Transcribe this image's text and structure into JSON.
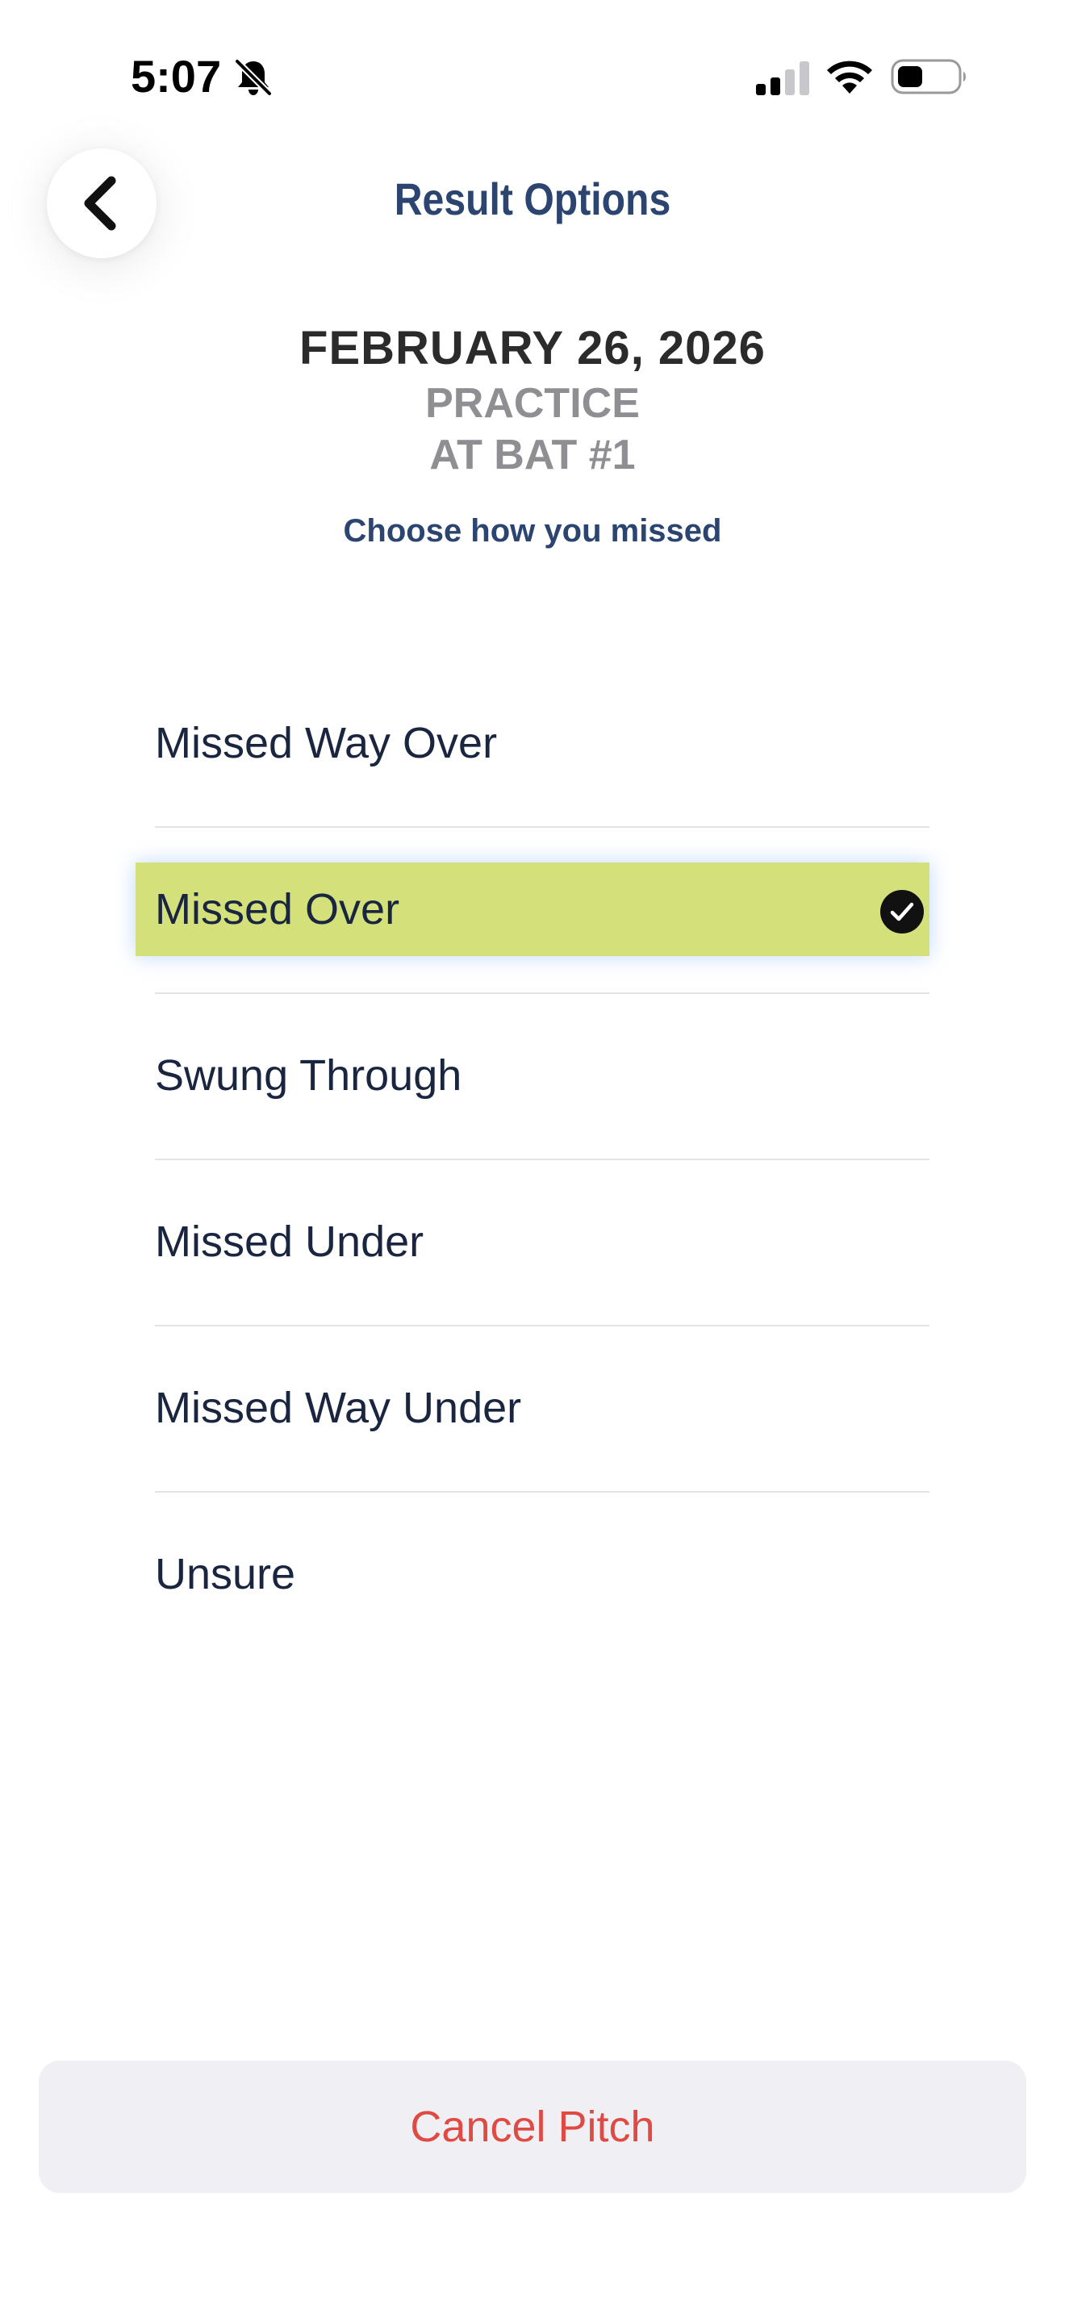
{
  "status_bar": {
    "time": "5:07",
    "icons": [
      "bell-slash-icon",
      "cellular-signal-icon",
      "wifi-icon",
      "battery-icon"
    ],
    "battery_level": 0.3
  },
  "header": {
    "title": "Result Options",
    "back_icon": "chevron-left-icon"
  },
  "context": {
    "date": "FEBRUARY 26, 2026",
    "session": "PRACTICE",
    "at_bat": "AT BAT #1",
    "instruction": "Choose how you missed"
  },
  "options": {
    "items": [
      {
        "label": "Missed Way Over",
        "selected": false
      },
      {
        "label": "Missed Over",
        "selected": true
      },
      {
        "label": "Swung Through",
        "selected": false
      },
      {
        "label": "Missed Under",
        "selected": false
      },
      {
        "label": "Missed Way Under",
        "selected": false
      },
      {
        "label": "Unsure",
        "selected": false
      }
    ],
    "selected_icon": "checkmark-circle-icon"
  },
  "footer": {
    "cancel_label": "Cancel Pitch"
  },
  "colors": {
    "title": "#2c4470",
    "subtitle_gray": "#8e8e93",
    "selected_highlight": "#d4e17b",
    "cancel_text": "#e04a44",
    "cancel_bg": "#f0f0f4"
  }
}
